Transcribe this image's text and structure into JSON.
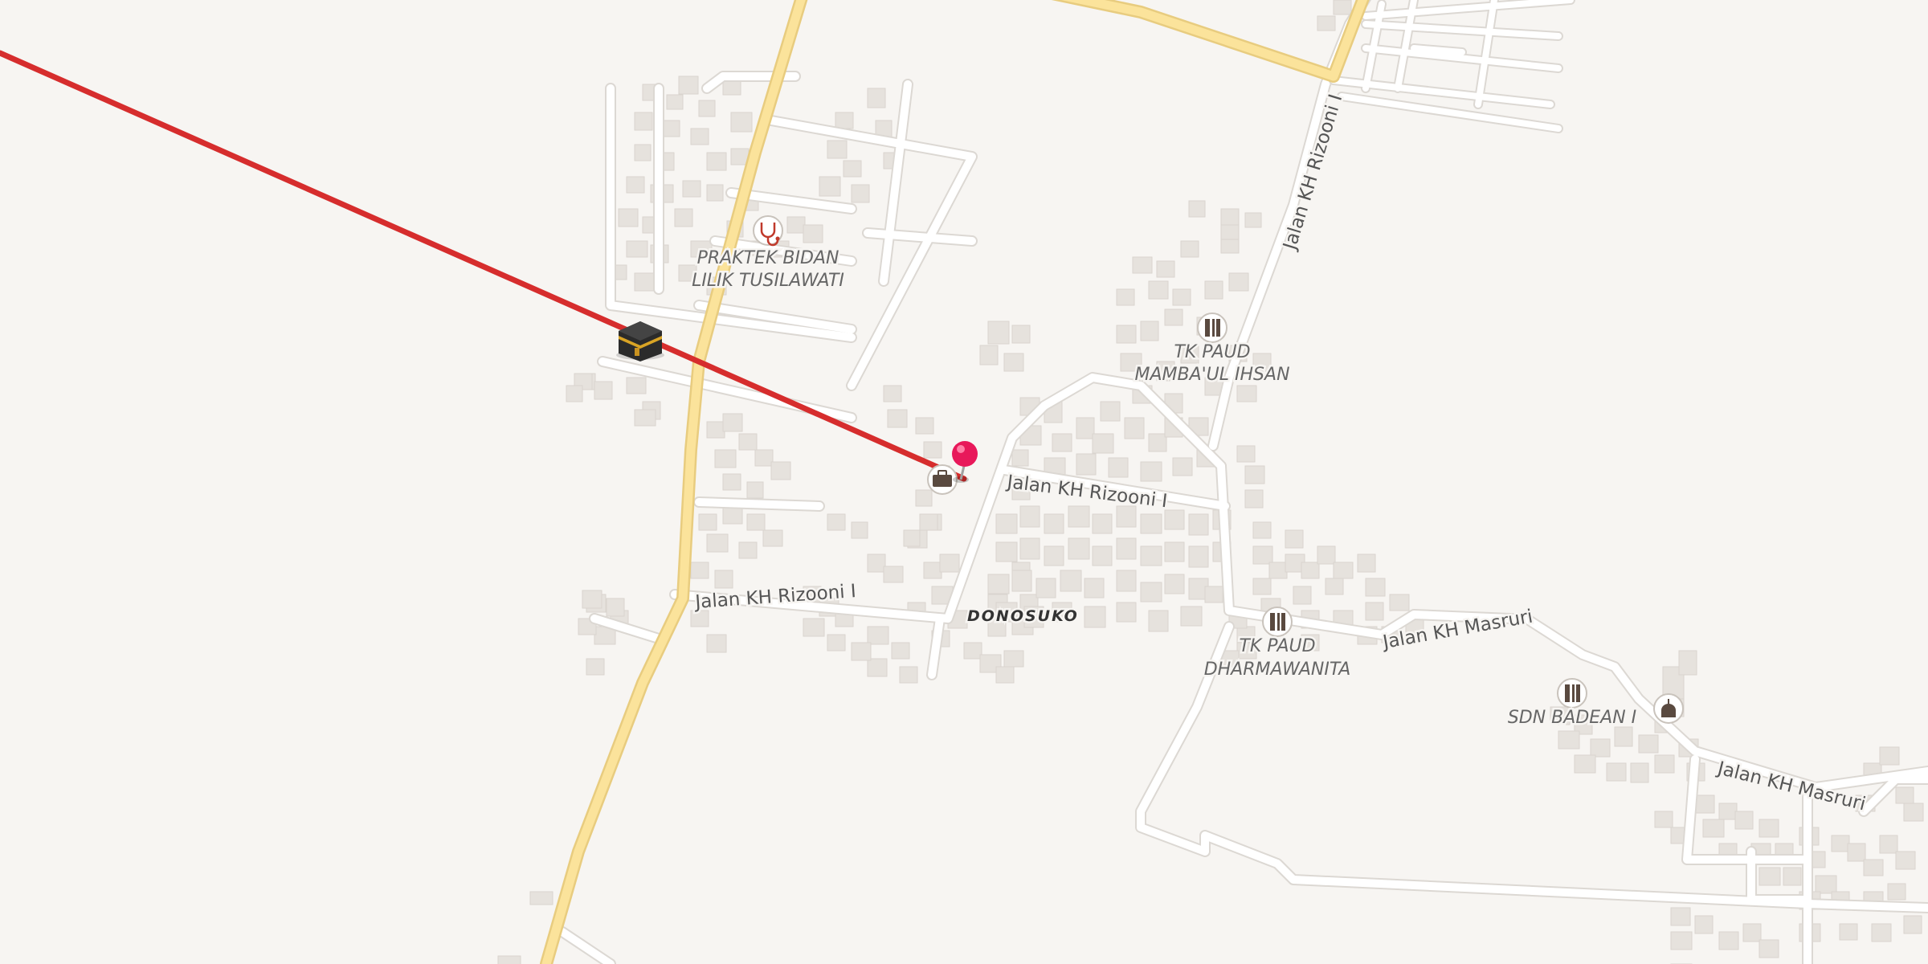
{
  "map": {
    "streets": [
      {
        "id": "rizooni-north",
        "label": "Jalan KH Rizooni I"
      },
      {
        "id": "rizooni-middle",
        "label": "Jalan KH Rizooni I"
      },
      {
        "id": "rizooni-west",
        "label": "Jalan KH Rizooni I"
      },
      {
        "id": "masruri-east",
        "label": "Jalan KH Masruri"
      },
      {
        "id": "masruri-southeast",
        "label": "Jalan KH Masruri"
      }
    ],
    "place": {
      "label": "DONOSUKO"
    },
    "pois": [
      {
        "id": "praktek-bidan",
        "line1": "PRAKTEK BIDAN",
        "line2": "LILIK TUSILAWATI",
        "icon": "stethoscope-icon"
      },
      {
        "id": "tk-paud-mambaul",
        "line1": "TK PAUD",
        "line2": "MAMBA'UL IHSAN",
        "icon": "school-icon"
      },
      {
        "id": "tk-paud-dharmawanita",
        "line1": "TK PAUD",
        "line2": "DHARMAWANITA",
        "icon": "school-icon"
      },
      {
        "id": "sdn-badean",
        "line1": "SDN BADEAN I",
        "icon": "school-icon"
      },
      {
        "id": "mosque",
        "icon": "mosque-icon"
      },
      {
        "id": "office",
        "icon": "briefcase-icon"
      }
    ],
    "markers": {
      "pin": "location-pin-icon",
      "qibla": "kaaba-icon"
    },
    "colors": {
      "background": "#f7f5f2",
      "road": "#ffffff",
      "main_road": "#fbe39b",
      "building": "#e8e4df",
      "qibla_line": "#d62d2d",
      "pin": "#e8185a"
    }
  }
}
